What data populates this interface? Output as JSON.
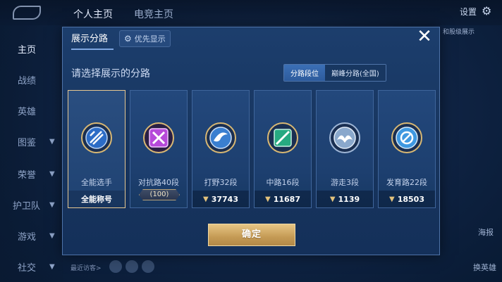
{
  "background": {
    "top_tabs": [
      "个人主页",
      "电竞主页"
    ],
    "settings_label": "设置",
    "hint_text": "和股级展示",
    "sidebar_items": [
      "主页",
      "战绩",
      "英雄",
      "图鉴",
      "荣誉",
      "护卫队",
      "游戏",
      "社交"
    ],
    "right_labels": [
      "海报",
      "换英雄"
    ],
    "recent_visitors": "最近访客>"
  },
  "modal": {
    "title_tab": "展示分路",
    "priority_tab": "优先显示",
    "prompt": "请选择展示的分路",
    "segments": [
      {
        "label": "分路段位",
        "active": true
      },
      {
        "label": "巅峰分路(全国)",
        "active": false
      }
    ],
    "cards": [
      {
        "name": "全能选手",
        "footer": "全能称号",
        "selected": true,
        "coin": false,
        "emblem": "all-role-emblem-icon",
        "color": "#3d7fd8"
      },
      {
        "name": "对抗路40段",
        "footer": "",
        "selected": false,
        "coin": false,
        "badge": "100",
        "emblem": "clash-lane-emblem-icon",
        "color": "#c24be0"
      },
      {
        "name": "打野32段",
        "footer": "37743",
        "selected": false,
        "coin": true,
        "emblem": "jungle-emblem-icon",
        "color": "#3e86d6"
      },
      {
        "name": "中路16段",
        "footer": "11687",
        "selected": false,
        "coin": true,
        "emblem": "mid-lane-emblem-icon",
        "color": "#2fb98c"
      },
      {
        "name": "游走3段",
        "footer": "1139",
        "selected": false,
        "coin": true,
        "emblem": "roam-emblem-icon",
        "color": "#9ab7d8"
      },
      {
        "name": "发育路22段",
        "footer": "18503",
        "selected": false,
        "coin": true,
        "emblem": "farm-lane-emblem-icon",
        "color": "#4aa3e6"
      }
    ],
    "confirm_label": "确定",
    "close_symbol": "✕"
  },
  "colors": {
    "accent_gold": "#e6c585",
    "panel_blue": "#1c3e6d",
    "selected_border": "#e7c891"
  }
}
